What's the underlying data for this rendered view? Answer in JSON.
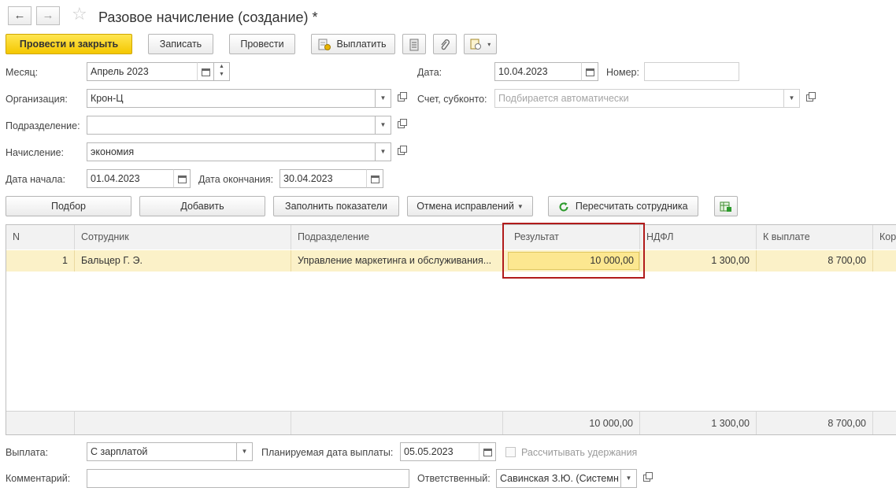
{
  "header": {
    "title": "Разовое начисление (создание) *",
    "back_icon": "←",
    "forward_icon": "→",
    "star_icon": "☆"
  },
  "toolbar": {
    "post_close": "Провести и закрыть",
    "save": "Записать",
    "post": "Провести",
    "pay": "Выплатить",
    "more_caret": "▾"
  },
  "form": {
    "month_label": "Месяц:",
    "month_value": "Апрель 2023",
    "date_label": "Дата:",
    "date_value": "10.04.2023",
    "number_label": "Номер:",
    "number_value": "",
    "org_label": "Организация:",
    "org_value": "Крон-Ц",
    "account_label": "Счет, субконто:",
    "account_placeholder": "Подбирается автоматически",
    "dept_label": "Подразделение:",
    "dept_value": "",
    "accrual_label": "Начисление:",
    "accrual_value": "экономия",
    "start_label": "Дата начала:",
    "start_value": "01.04.2023",
    "end_label": "Дата окончания:",
    "end_value": "30.04.2023"
  },
  "table_toolbar": {
    "select": "Подбор",
    "add": "Добавить",
    "fill": "Заполнить показатели",
    "cancel_fix": "Отмена исправлений",
    "recalc": "Пересчитать сотрудника"
  },
  "table": {
    "columns": [
      "N",
      "Сотрудник",
      "Подразделение",
      "Результат",
      "НДФЛ",
      "К выплате",
      "Кор"
    ],
    "rows": [
      {
        "n": "1",
        "employee": "Бальцер Г. Э.",
        "dept": "Управление маркетинга и обслуживания...",
        "result": "10 000,00",
        "ndfl": "1 300,00",
        "payout": "8 700,00"
      }
    ],
    "totals": {
      "result": "10 000,00",
      "ndfl": "1 300,00",
      "payout": "8 700,00"
    }
  },
  "footer": {
    "payment_label": "Выплата:",
    "payment_value": "С зарплатой",
    "planned_label": "Планируемая дата выплаты:",
    "planned_value": "05.05.2023",
    "withhold_label": "Рассчитывать удержания",
    "comment_label": "Комментарий:",
    "comment_value": "",
    "resp_label": "Ответственный:",
    "resp_value": "Савинская З.Ю. (Системн"
  },
  "colors": {
    "primary_button": "#f4c700",
    "selected_row": "#fbf1c8",
    "highlight_frame": "#b11b1b",
    "recalc_icon": "#2c9a2c"
  }
}
